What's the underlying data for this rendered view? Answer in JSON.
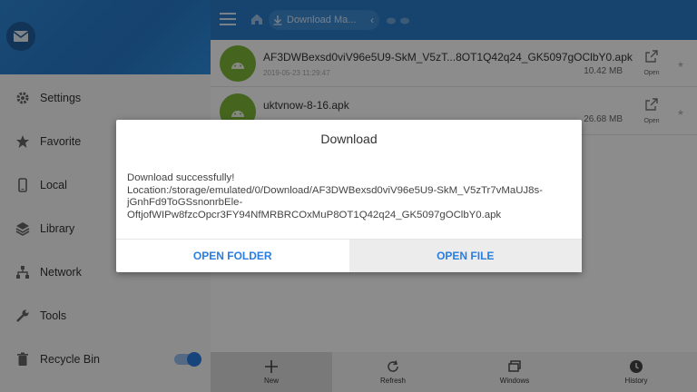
{
  "sidebar": {
    "items": [
      {
        "label": "Settings",
        "icon": "gear-icon"
      },
      {
        "label": "Favorite",
        "icon": "star-icon"
      },
      {
        "label": "Local",
        "icon": "phone-icon"
      },
      {
        "label": "Library",
        "icon": "layers-icon"
      },
      {
        "label": "Network",
        "icon": "network-icon"
      },
      {
        "label": "Tools",
        "icon": "wrench-icon"
      },
      {
        "label": "Recycle Bin",
        "icon": "trash-icon",
        "toggle_on": true
      }
    ]
  },
  "topbar": {
    "breadcrumb": "Download Ma..."
  },
  "files": [
    {
      "name": "AF3DWBexsd0viV96e5U9-SkM_V5zT...8OT1Q42q24_GK5097gOClbY0.apk",
      "date": "2019-05-23 11:29:47",
      "size": "10.42 MB",
      "open_label": "Open"
    },
    {
      "name": "uktvnow-8-16.apk",
      "date": "",
      "size": "26.68 MB",
      "open_label": "Open"
    }
  ],
  "bottom_bar": {
    "new": "New",
    "refresh": "Refresh",
    "windows": "Windows",
    "history": "History"
  },
  "dialog": {
    "title": "Download",
    "message_lines": [
      "Download  successfully!",
      "Location:/storage/emulated/0/Download/AF3DWBexsd0viV96e5U9-SkM_V5zTr7vMaUJ8s-",
      "jGnhFd9ToGSsnonrbEle-",
      "OftjofWIPw8fzcOpcr3FY94NfMRBRCOxMuP8OT1Q42q24_GK5097gOClbY0.apk"
    ],
    "open_folder": "OPEN FOLDER",
    "open_file": "OPEN FILE"
  },
  "colors": {
    "accent": "#2a7de1",
    "topbar": "#2a7cc9",
    "apk_icon": "#7fb83a"
  }
}
